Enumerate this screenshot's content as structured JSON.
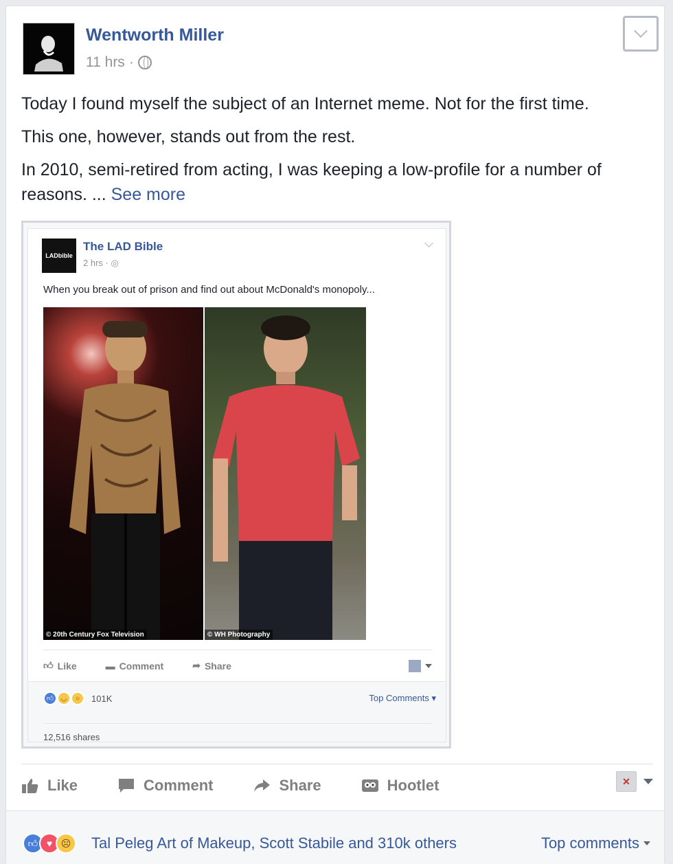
{
  "post": {
    "author": "Wentworth Miller",
    "time": "11 hrs",
    "dot": "·",
    "text": [
      "Today I found myself the subject of an Internet meme. Not for the first time.",
      "This one, however, stands out from the rest.",
      "In 2010, semi-retired from acting, I was keeping a low-profile for a number of reasons. ..."
    ],
    "see_more": "See more"
  },
  "shared": {
    "page": "The LAD Bible",
    "logo_text": "LADbible",
    "time": "2 hrs",
    "dot": "·",
    "caption": "When you break out of prison and find out about McDonald's monopoly...",
    "credit_left": "© 20th Century Fox Television",
    "credit_right": "© WH Photography",
    "actions": {
      "like": "Like",
      "comment": "Comment",
      "share": "Share"
    },
    "reaction_count": "101K",
    "top_comments": "Top Comments",
    "shares": "12,516 shares"
  },
  "actions": {
    "like": "Like",
    "comment": "Comment",
    "share": "Share",
    "hootlet": "Hootlet"
  },
  "summary": {
    "text": "Tal Peleg Art of Makeup, Scott Stabile and 310k others",
    "top_comments": "Top comments"
  },
  "colors": {
    "link": "#365899",
    "muted": "#90949c",
    "action": "#7f7f7f"
  }
}
